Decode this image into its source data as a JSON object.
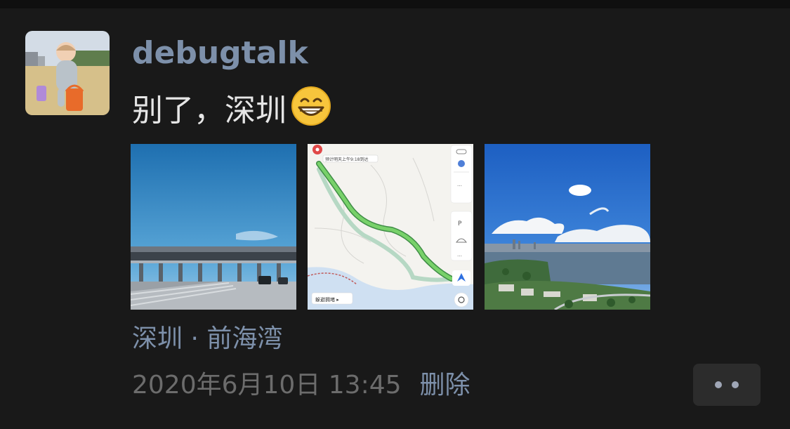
{
  "post": {
    "author": "debugtalk",
    "text": "别了，深圳",
    "emoji": "grinning-face-emoji",
    "location": "深圳 · 前海湾",
    "time": "2020年6月10日 13:45",
    "delete_label": "删除"
  },
  "photos": [
    {
      "name": "photo-toll-gate",
      "icon": "toll-gate-highway"
    },
    {
      "name": "photo-route-map",
      "icon": "map-route",
      "labels": {
        "eta": "预计明天上午9:18到达",
        "bottom_pill": "躲避拥堵 ▸"
      }
    },
    {
      "name": "photo-bay-skyline",
      "icon": "bay-skyline"
    }
  ],
  "colors": {
    "background": "#191919",
    "author_link": "#7d90aa",
    "body_text": "#e6e6e6",
    "timestamp": "#6c6c6c",
    "more_button": "#2c2c2c"
  }
}
